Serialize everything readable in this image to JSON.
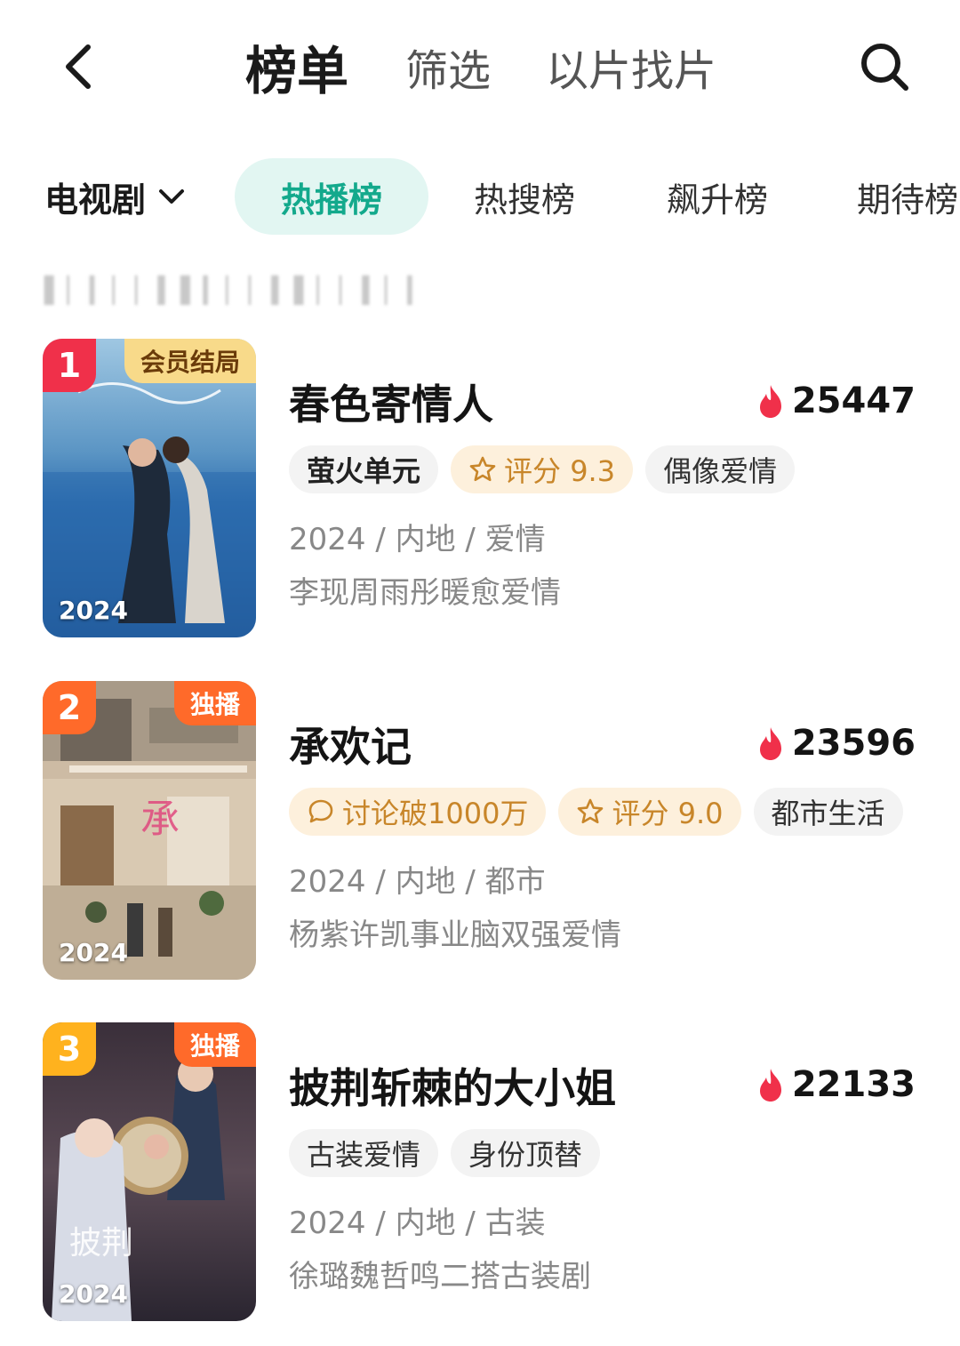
{
  "header": {
    "tabs": [
      {
        "label": "榜单",
        "active": true
      },
      {
        "label": "筛选",
        "active": false
      },
      {
        "label": "以片找片",
        "active": false
      }
    ]
  },
  "category": {
    "selected": "电视剧",
    "rank_tabs": [
      {
        "label": "热播榜",
        "active": true
      },
      {
        "label": "热搜榜",
        "active": false
      },
      {
        "label": "飙升榜",
        "active": false
      },
      {
        "label": "期待榜",
        "active": false
      }
    ]
  },
  "entries": [
    {
      "rank": "1",
      "rank_color": "#f0304a",
      "corner_tag": "会员结局",
      "poster_year": "2024",
      "title": "春色寄情人",
      "heat": "25447",
      "tags": [
        {
          "label": "萤火单元",
          "style": "brand"
        },
        {
          "label": "评分 9.3",
          "style": "orange",
          "icon": "star-icon"
        },
        {
          "label": "偶像爱情",
          "style": "plain"
        }
      ],
      "meta": "2024 / 内地 / 爱情",
      "desc": "李现周雨彤暖愈爱情"
    },
    {
      "rank": "2",
      "rank_color": "#ff6a2a",
      "corner_tag": "独播",
      "poster_year": "2024",
      "title": "承欢记",
      "heat": "23596",
      "tags": [
        {
          "label": "讨论破1000万",
          "style": "orange",
          "icon": "comment-icon"
        },
        {
          "label": "评分 9.0",
          "style": "orange",
          "icon": "star-icon"
        },
        {
          "label": "都市生活",
          "style": "plain"
        }
      ],
      "meta": "2024 / 内地 / 都市",
      "desc": "杨紫许凯事业脑双强爱情"
    },
    {
      "rank": "3",
      "rank_color": "#ffb21e",
      "corner_tag": "独播",
      "poster_year": "2024",
      "title": "披荆斩棘的大小姐",
      "heat": "22133",
      "tags": [
        {
          "label": "古装爱情",
          "style": "plain"
        },
        {
          "label": "身份顶替",
          "style": "plain"
        }
      ],
      "meta": "2024 / 内地 / 古装",
      "desc": "徐璐魏哲鸣二搭古装剧"
    }
  ],
  "colors": {
    "accent": "#13a98c",
    "accent_bg": "#e2f6f2",
    "heat_flame": "#f0304a",
    "orange_tag_text": "#c8862a",
    "orange_tag_bg": "#fdf0dc"
  }
}
